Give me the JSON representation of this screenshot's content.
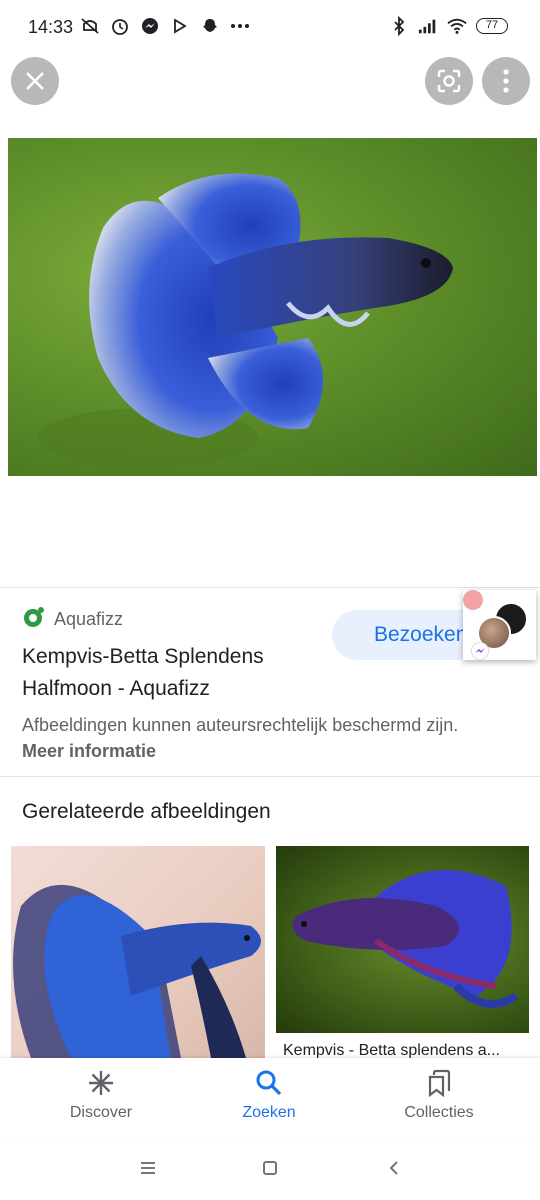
{
  "status_bar": {
    "time": "14:33",
    "battery": "77",
    "left_icons": [
      "mute-icon",
      "alarm-icon",
      "messenger-icon",
      "play-store-icon",
      "snapchat-icon",
      "more-dots-icon"
    ],
    "right_icons": [
      "bluetooth-icon",
      "signal-icon",
      "wifi-icon",
      "battery-icon"
    ]
  },
  "top_bar": {
    "close_icon": "close-icon",
    "lens_icon": "lens-icon",
    "more_icon": "more-vert-icon"
  },
  "result": {
    "source_name": "Aquafizz",
    "title": "Kempvis-Betta Splendens Halfmoon - Aquafizz",
    "visit_label": "Bezoeken",
    "notice_text": "Afbeeldingen kunnen auteursrechtelijk beschermd zijn. ",
    "notice_link": "Meer informatie"
  },
  "related": {
    "heading": "Gerelateerde afbeeldingen",
    "items": [
      {
        "caption": ""
      },
      {
        "caption": "Kempvis - Betta splendens a..."
      }
    ]
  },
  "bottom_nav": {
    "items": [
      {
        "label": "Discover",
        "icon": "asterisk-icon"
      },
      {
        "label": "Zoeken",
        "icon": "search-icon"
      },
      {
        "label": "Collecties",
        "icon": "collections-icon"
      }
    ],
    "active": "Zoeken"
  },
  "colors": {
    "accent": "#1a73e8",
    "visit_bg": "#e8f0fe",
    "text_secondary": "#5f6368"
  }
}
